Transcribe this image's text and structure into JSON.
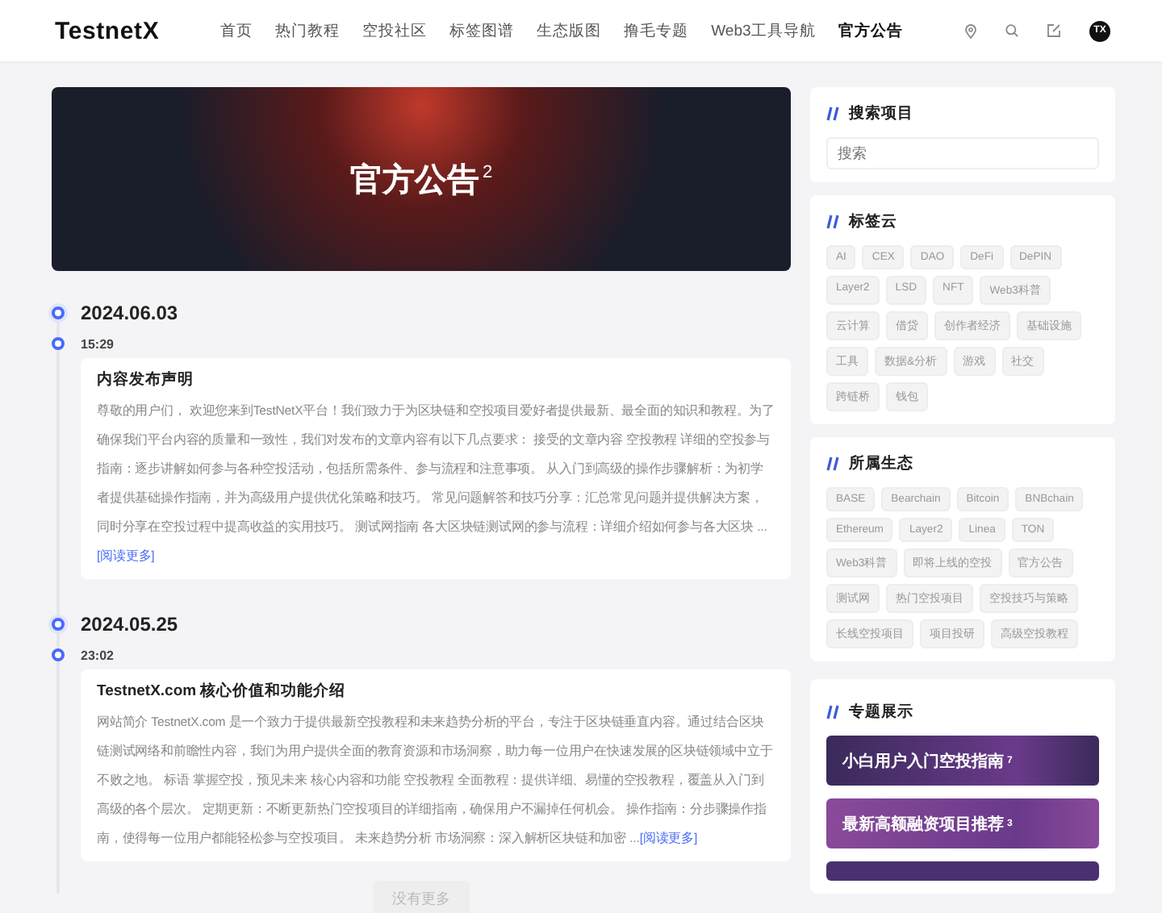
{
  "header": {
    "logo": "TestnetX",
    "nav": [
      {
        "label": "首页",
        "selected": false
      },
      {
        "label": "热门教程",
        "selected": false
      },
      {
        "label": "空投社区",
        "selected": false
      },
      {
        "label": "标签图谱",
        "selected": false
      },
      {
        "label": "生态版图",
        "selected": false
      },
      {
        "label": "撸毛专题",
        "selected": false
      },
      {
        "label": "Web3工具导航",
        "selected": false
      },
      {
        "label": "官方公告",
        "selected": true
      }
    ],
    "avatar": "TX"
  },
  "hero": {
    "title": "官方公告",
    "count": "2"
  },
  "timeline": [
    {
      "date": "2024.06.03",
      "entries": [
        {
          "time": "15:29",
          "title": "内容发布声明",
          "body": "尊敬的用户们， 欢迎您来到TestNetX平台！我们致力于为区块链和空投项目爱好者提供最新、最全面的知识和教程。为了确保我们平台内容的质量和一致性，我们对发布的文章内容有以下几点要求： 接受的文章内容 空投教程 详细的空投参与指南：逐步讲解如何参与各种空投活动，包括所需条件、参与流程和注意事项。 从入门到高级的操作步骤解析：为初学者提供基础操作指南，并为高级用户提供优化策略和技巧。 常见问题解答和技巧分享：汇总常见问题并提供解决方案，同时分享在空投过程中提高收益的实用技巧。 测试网指南 各大区块链测试网的参与流程：详细介绍如何参与各大区块 ...",
          "read_more": "[阅读更多]"
        }
      ]
    },
    {
      "date": "2024.05.25",
      "entries": [
        {
          "time": "23:02",
          "title": "TestnetX.com 核心价值和功能介绍",
          "body": "网站简介 TestnetX.com 是一个致力于提供最新空投教程和未来趋势分析的平台，专注于区块链垂直内容。通过结合区块链测试网络和前瞻性内容，我们为用户提供全面的教育资源和市场洞察，助力每一位用户在快速发展的区块链领域中立于不败之地。 标语 掌握空投，预见未来 核心内容和功能 空投教程 全面教程：提供详细、易懂的空投教程，覆盖从入门到高级的各个层次。 定期更新：不断更新热门空投项目的详细指南，确保用户不漏掉任何机会。 操作指南：分步骤操作指南，使得每一位用户都能轻松参与空投项目。 未来趋势分析 市场洞察：深入解析区块链和加密 ...",
          "read_more": "[阅读更多]"
        }
      ]
    }
  ],
  "load_more": {
    "label": "没有更多",
    "disabled": true
  },
  "sidebar": {
    "search": {
      "title": "搜索项目",
      "placeholder": "搜索"
    },
    "tag_cloud": {
      "title": "标签云",
      "tags": [
        "AI",
        "CEX",
        "DAO",
        "DeFi",
        "DePIN",
        "Layer2",
        "LSD",
        "NFT",
        "Web3科普",
        "云计算",
        "借贷",
        "创作者经济",
        "基础设施",
        "工具",
        "数据&分析",
        "游戏",
        "社交",
        "跨链桥",
        "钱包"
      ]
    },
    "ecosystems": {
      "title": "所属生态",
      "tags": [
        "BASE",
        "Bearchain",
        "Bitcoin",
        "BNBchain",
        "Ethereum",
        "Layer2",
        "Linea",
        "TON",
        "Web3科普",
        "即将上线的空投",
        "官方公告",
        "测试网",
        "热门空投项目",
        "空投技巧与策略",
        "长线空投项目",
        "项目投研",
        "高级空投教程"
      ]
    },
    "topics": {
      "title": "专题展示",
      "items": [
        {
          "title": "小白用户入门空投指南",
          "count": "7",
          "color": "#3a2a5a"
        },
        {
          "title": "最新高额融资项目推荐",
          "count": "3",
          "color": "#8a4a9a"
        }
      ]
    }
  }
}
